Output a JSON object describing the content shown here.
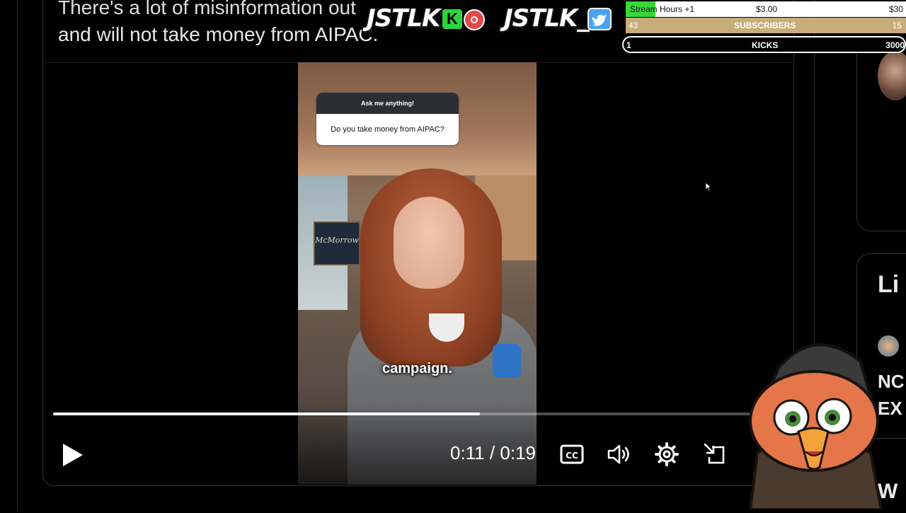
{
  "tweet": {
    "text_line1": "There's a lot of misinformation out",
    "text_line2": "and will not take money from AIPAC."
  },
  "video": {
    "ama_header": "Ask me anything!",
    "ama_question": "Do you take money from AIPAC?",
    "sign_text": "McMorrow",
    "caption": "campaign.",
    "progress": 0.58
  },
  "player": {
    "current_time": "0:11",
    "separator": "/",
    "duration": "0:19",
    "cc_label": "CC"
  },
  "overlay": {
    "brand_left": "JSTLK",
    "brand_right": "JSTLK_",
    "k_badge": "K",
    "stats": {
      "row1_label": "Stream Hours +1",
      "row1_value": "$3.00",
      "row1_right": "$30",
      "row2_left": "43",
      "row2_label": "SUBSCRIBERS",
      "row2_right": "15",
      "row3_left": "1",
      "row3_label": "KICKS",
      "row3_right": "3000"
    }
  },
  "right_panel": {
    "heading": "Li",
    "line1": "NC",
    "line2": "EX",
    "bottom": "W"
  },
  "colors": {
    "background": "#000000",
    "border": "#2f3336",
    "kick_green": "#39d63b",
    "subs_bar": "#c8ad7a",
    "twitter_blue": "#4aa3f0"
  },
  "icons": [
    "play-icon",
    "captions-icon",
    "volume-icon",
    "settings-icon",
    "popout-icon",
    "cursor-icon",
    "record-icon",
    "twitter-icon",
    "kick-icon"
  ]
}
